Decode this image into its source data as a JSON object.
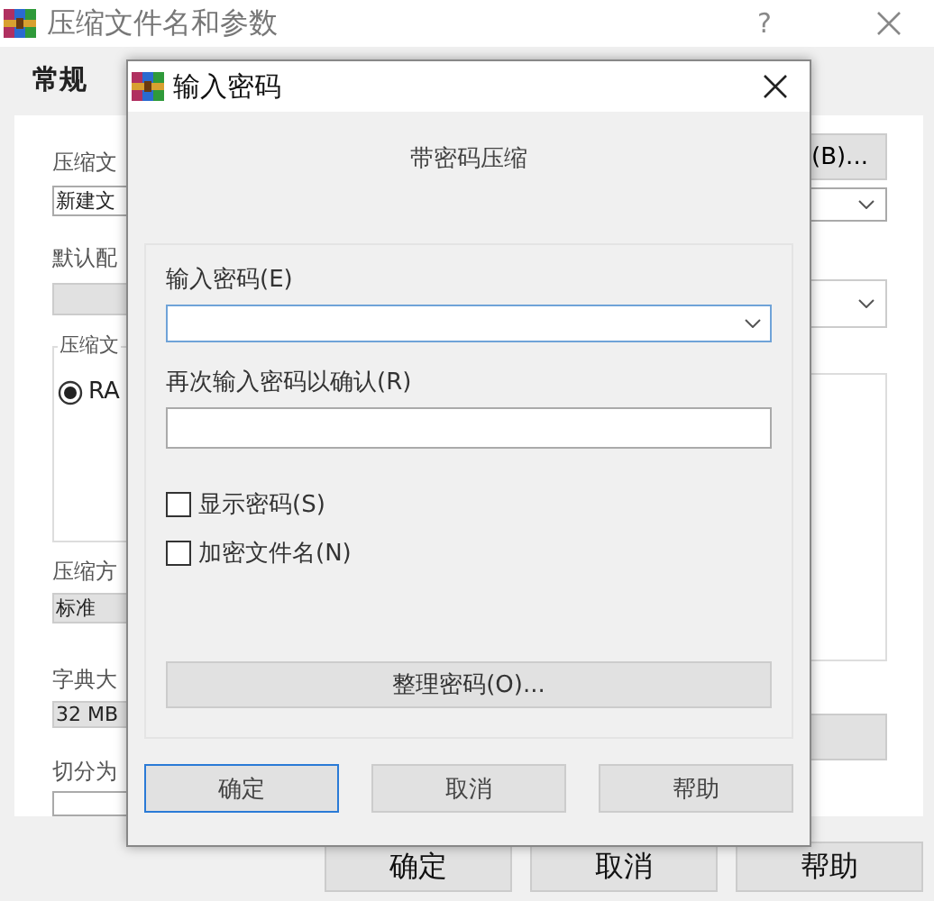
{
  "window": {
    "title": "压缩文件名和参数",
    "help": "?"
  },
  "tabs": [
    {
      "label": "常规",
      "selected": true
    }
  ],
  "background_form": {
    "archive_name_label": "压缩文",
    "browse_button": "(B)...",
    "archive_name_value": "新建文",
    "profile_label": "默认配",
    "format_group_label": "压缩文",
    "format_options": [
      {
        "label": "RA",
        "selected": true
      }
    ],
    "method_label": "压缩方",
    "method_value": "标准",
    "dictionary_label": "字典大",
    "dictionary_value": "32 MB",
    "split_label": "切分为"
  },
  "buttons": [
    {
      "label": "确定"
    },
    {
      "label": "取消"
    },
    {
      "label": "帮助"
    }
  ],
  "password_dialog": {
    "title": "输入密码",
    "heading": "带密码压缩",
    "password_label": "输入密码(E)",
    "password_focused": true,
    "confirm_label": "再次输入密码以确认(R)",
    "options": [
      {
        "label": "显示密码(S)",
        "checked": false
      },
      {
        "label": "加密文件名(N)",
        "checked": false
      }
    ],
    "organize_button": "整理密码(O)...",
    "buttons": [
      {
        "label": "确定",
        "default": true
      },
      {
        "label": "取消",
        "default": false
      },
      {
        "label": "帮助",
        "default": false
      }
    ]
  }
}
